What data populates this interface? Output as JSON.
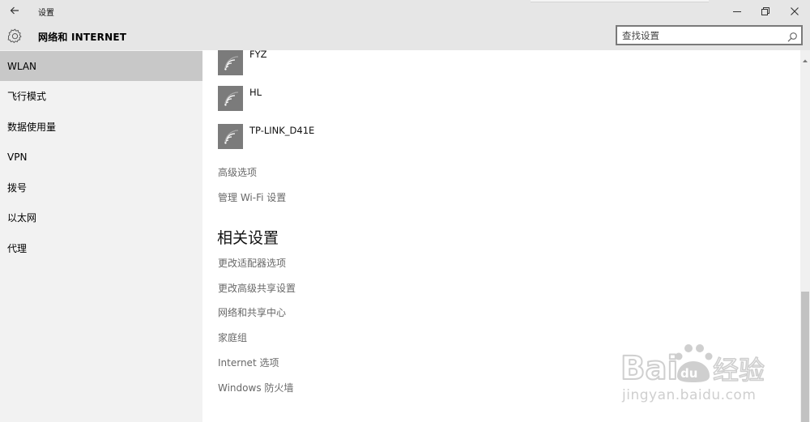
{
  "window": {
    "app_title": "设置",
    "icons": {
      "back": "back-arrow-icon",
      "minimize": "minimize-icon",
      "maximize": "restore-icon",
      "close": "close-icon"
    }
  },
  "header": {
    "section_title": "网络和 INTERNET",
    "search_placeholder": "查找设置",
    "icons": {
      "gear": "gear-icon",
      "search": "search-icon"
    }
  },
  "sidebar": {
    "items": [
      {
        "label": "WLAN",
        "selected": true
      },
      {
        "label": "飞行模式",
        "selected": false
      },
      {
        "label": "数据使用量",
        "selected": false
      },
      {
        "label": "VPN",
        "selected": false
      },
      {
        "label": "拨号",
        "selected": false
      },
      {
        "label": "以太网",
        "selected": false
      },
      {
        "label": "代理",
        "selected": false
      }
    ]
  },
  "main": {
    "networks": [
      {
        "name": "FYZ"
      },
      {
        "name": "HL"
      },
      {
        "name": "TP-LINK_D41E"
      }
    ],
    "links": {
      "advanced": "高级选项",
      "manage_wifi": "管理 Wi-Fi 设置"
    },
    "related": {
      "title": "相关设置",
      "links": [
        "更改适配器选项",
        "更改高级共享设置",
        "网络和共享中心",
        "家庭组",
        "Internet 选项",
        "Windows 防火墙"
      ]
    }
  },
  "watermark": {
    "logo_text": "Baidu经验",
    "url": "jingyan.baidu.com"
  },
  "colors": {
    "chrome": "#e6e6e6",
    "sidebar": "#f2f2f2",
    "selected": "#c8c8c8",
    "wifi_tile": "#7b7b7b",
    "link_text": "#686868"
  }
}
